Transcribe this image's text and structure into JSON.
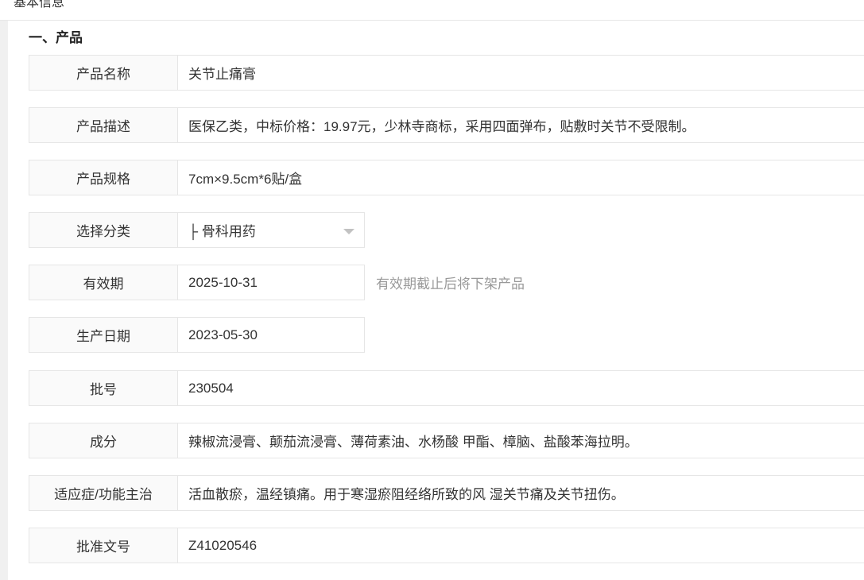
{
  "topbar": {
    "title": "基本信息"
  },
  "section": {
    "title": "一、产品"
  },
  "fields": {
    "name": {
      "label": "产品名称",
      "value": "关节止痛膏"
    },
    "description": {
      "label": "产品描述",
      "value": "医保乙类，中标价格：19.97元，少林寺商标，采用四面弹布，贴敷时关节不受限制。"
    },
    "spec": {
      "label": "产品规格",
      "value": "7cm×9.5cm*6贴/盒"
    },
    "category": {
      "label": "选择分类",
      "value": "├ 骨科用药"
    },
    "expiry": {
      "label": "有效期",
      "value": "2025-10-31",
      "hint": "有效期截止后将下架产品"
    },
    "production_date": {
      "label": "生产日期",
      "value": "2023-05-30"
    },
    "batch": {
      "label": "批号",
      "value": "230504"
    },
    "ingredients": {
      "label": "成分",
      "value": "辣椒流浸膏、颠茄流浸膏、薄荷素油、水杨酸 甲酯、樟脑、盐酸苯海拉明。"
    },
    "indications": {
      "label": "适应症/功能主治",
      "value": "活血散瘀，温经镇痛。用于寒湿瘀阻经络所致的风 湿关节痛及关节扭伤。"
    },
    "approval": {
      "label": "批准文号",
      "value": "Z41020546"
    }
  },
  "icons": {
    "select_arrow": "triangle-down-icon"
  },
  "colors": {
    "label_bg": "#fafafa",
    "border": "#e6e6e6",
    "hint": "#999999",
    "gutter": "#f0f0f0"
  }
}
